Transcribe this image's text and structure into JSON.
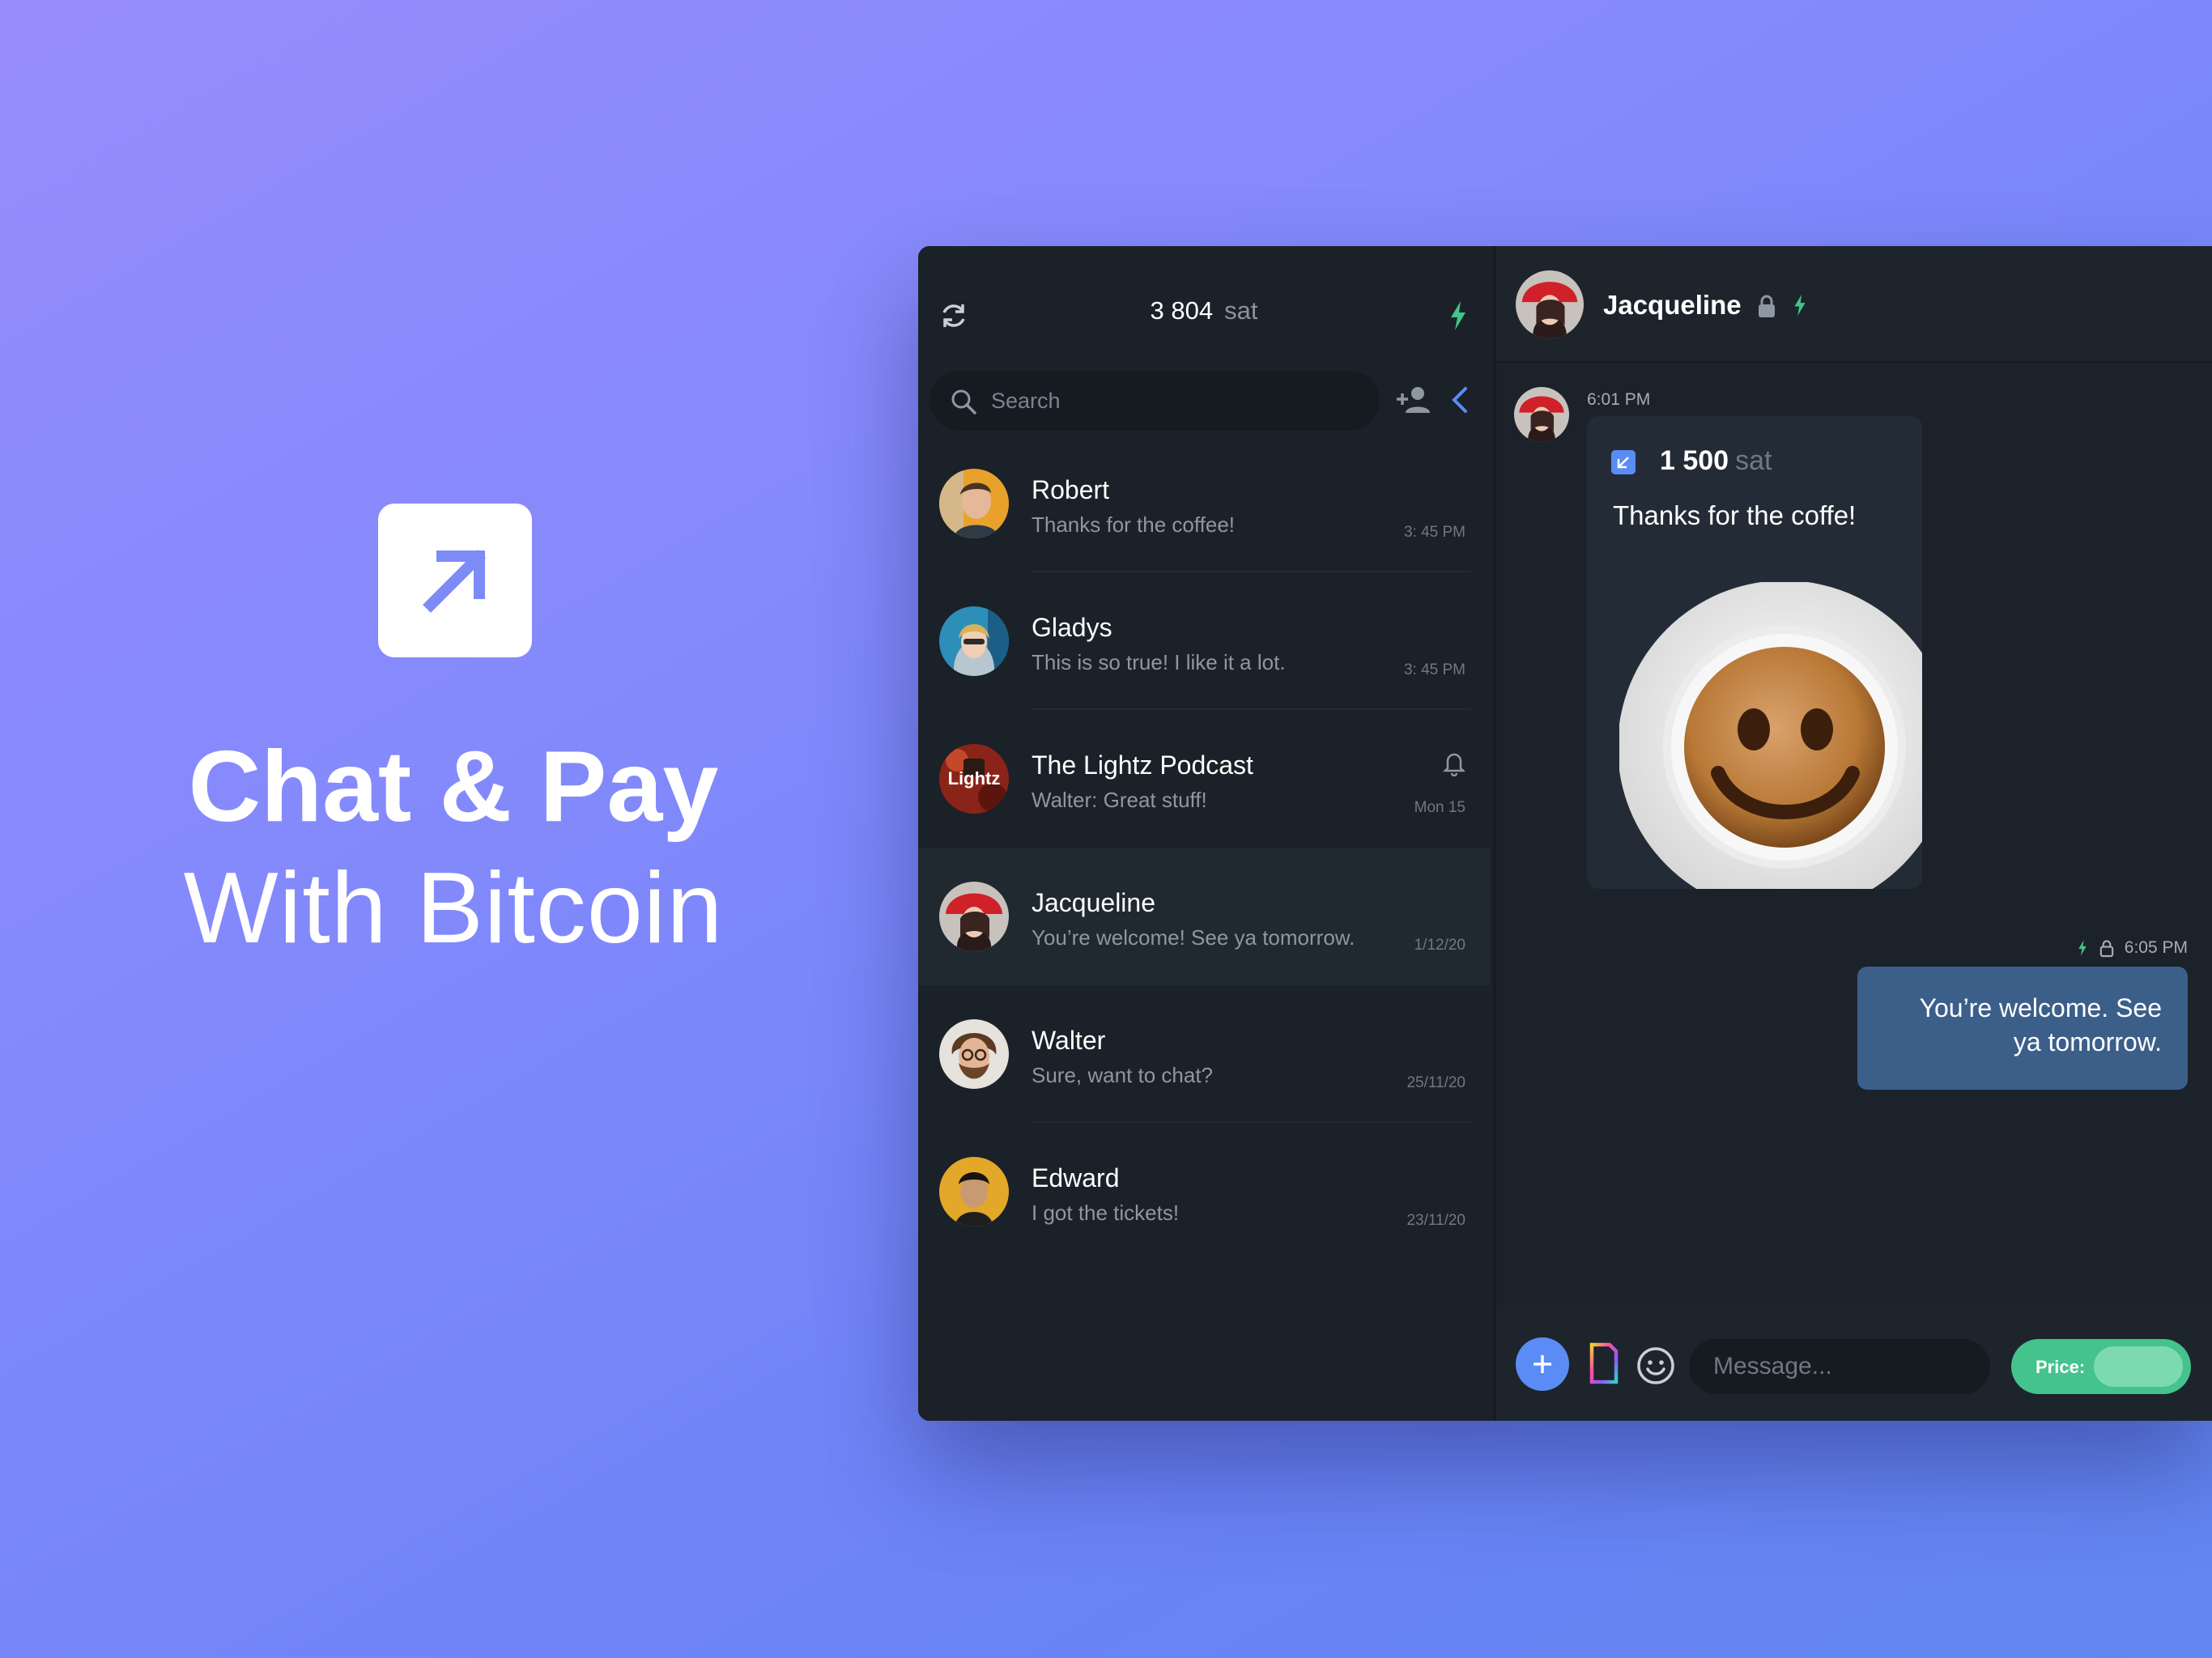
{
  "hero": {
    "title": "Chat & Pay",
    "subtitle": "With Bitcoin",
    "logo_icon": "arrow-up-right-icon"
  },
  "wallet": {
    "balance": "3 804",
    "unit": "sat"
  },
  "search": {
    "placeholder": "Search"
  },
  "conversations": [
    {
      "name": "Robert",
      "preview": "Thanks for the coffee!",
      "time": "3: 45 PM"
    },
    {
      "name": "Gladys",
      "preview": "This is so true! I like it a lot.",
      "time": "3: 45 PM"
    },
    {
      "name": "The Lightz Podcast",
      "preview": "Walter: Great stuff!",
      "time": "Mon 15",
      "avatar_text": "Lightz"
    },
    {
      "name": "Jacqueline",
      "preview": "You’re welcome! See ya tomorrow.",
      "time": "1/12/20",
      "active": true
    },
    {
      "name": "Walter",
      "preview": "Sure, want to chat?",
      "time": "25/11/20"
    },
    {
      "name": "Edward",
      "preview": "I got the tickets!",
      "time": "23/11/20"
    }
  ],
  "chat": {
    "contact_name": "Jacqueline",
    "messages": {
      "incoming": {
        "time": "6:01 PM",
        "amount": "1 500",
        "unit": "sat",
        "text": "Thanks for the coffe!"
      },
      "outgoing": {
        "time": "6:05 PM",
        "text": "You’re welcome. See ya tomorrow."
      }
    }
  },
  "composer": {
    "placeholder": "Message...",
    "price_label": "Price:"
  },
  "colors": {
    "accent_blue": "#5b8cf5",
    "lightning_green": "#44c38c",
    "window_bg": "#1b2128",
    "outgoing_bubble": "#3c5f8a"
  }
}
